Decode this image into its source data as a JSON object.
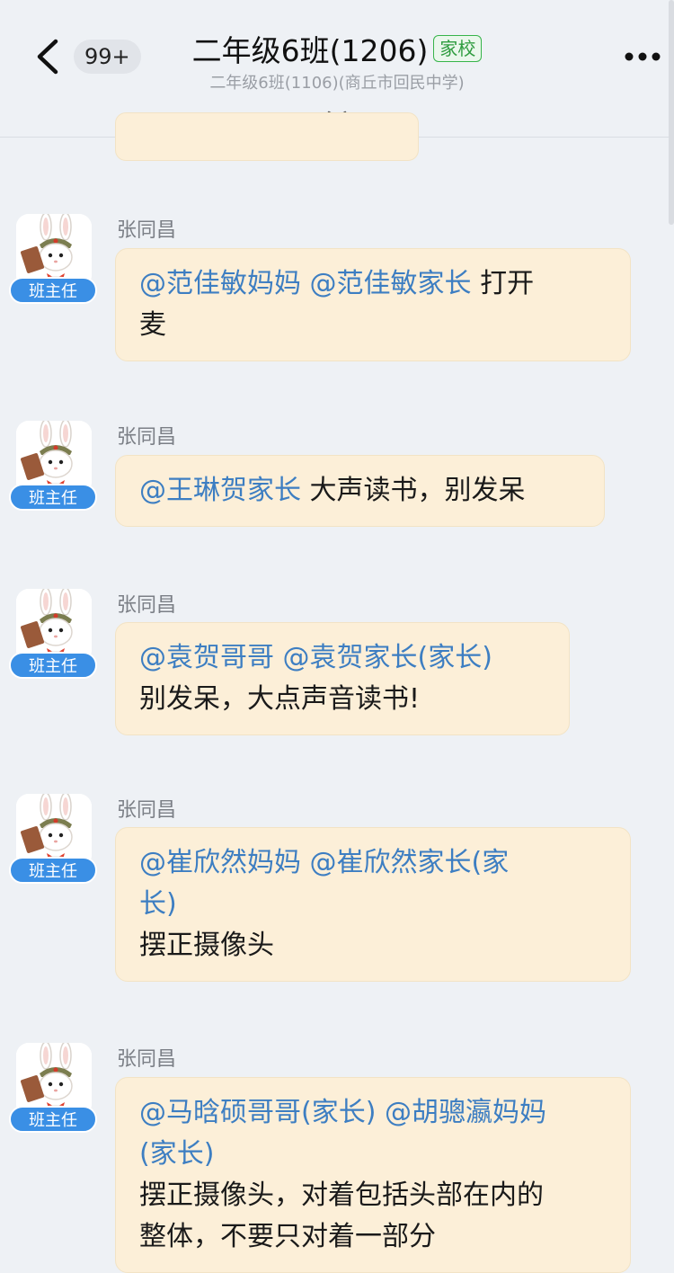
{
  "header": {
    "back_label": "<",
    "unread_count": "99+",
    "title": "二年级6班(1206)",
    "tag": "家校",
    "subtitle": "二年级6班(1106)(商丘市回民中学)",
    "more_label": "•••"
  },
  "messages": [
    {
      "sender": "张同昌",
      "role": "班主任",
      "lines": [
        {
          "mention": "@范佳敏妈妈 @范佳敏家长",
          "text": " 打开"
        },
        {
          "mention": "",
          "text": "麦"
        }
      ]
    },
    {
      "sender": "张同昌",
      "role": "班主任",
      "lines": [
        {
          "mention": "@王琳贺家长",
          "text": " 大声读书，别发呆"
        }
      ]
    },
    {
      "sender": "张同昌",
      "role": "班主任",
      "lines": [
        {
          "mention": "@袁贺哥哥 @袁贺家长(家长)",
          "text": ""
        },
        {
          "mention": "",
          "text": "别发呆，大点声音读书!"
        }
      ]
    },
    {
      "sender": "张同昌",
      "role": "班主任",
      "lines": [
        {
          "mention": "@崔欣然妈妈 @崔欣然家长(家",
          "text": ""
        },
        {
          "mention": "长)",
          "text": ""
        },
        {
          "mention": "",
          "text": "摆正摄像头"
        }
      ]
    },
    {
      "sender": "张同昌",
      "role": "班主任",
      "lines": [
        {
          "mention": "@马晗硕哥哥(家长) @胡骢瀛妈妈",
          "text": ""
        },
        {
          "mention": "(家长)",
          "text": ""
        },
        {
          "mention": "",
          "text": "摆正摄像头，对着包括头部在内的"
        },
        {
          "mention": "",
          "text": "整体，不要只对着一部分"
        }
      ]
    }
  ],
  "colors": {
    "background": "#eef1f5",
    "bubble": "#fcefd8",
    "mention": "#3d7ec2",
    "role_badge": "#3a8fe5",
    "tag_green": "#37b44a"
  },
  "icons": [
    "back-chevron-icon",
    "more-dots-icon",
    "pull-down-icon",
    "rabbit-avatar-icon"
  ]
}
